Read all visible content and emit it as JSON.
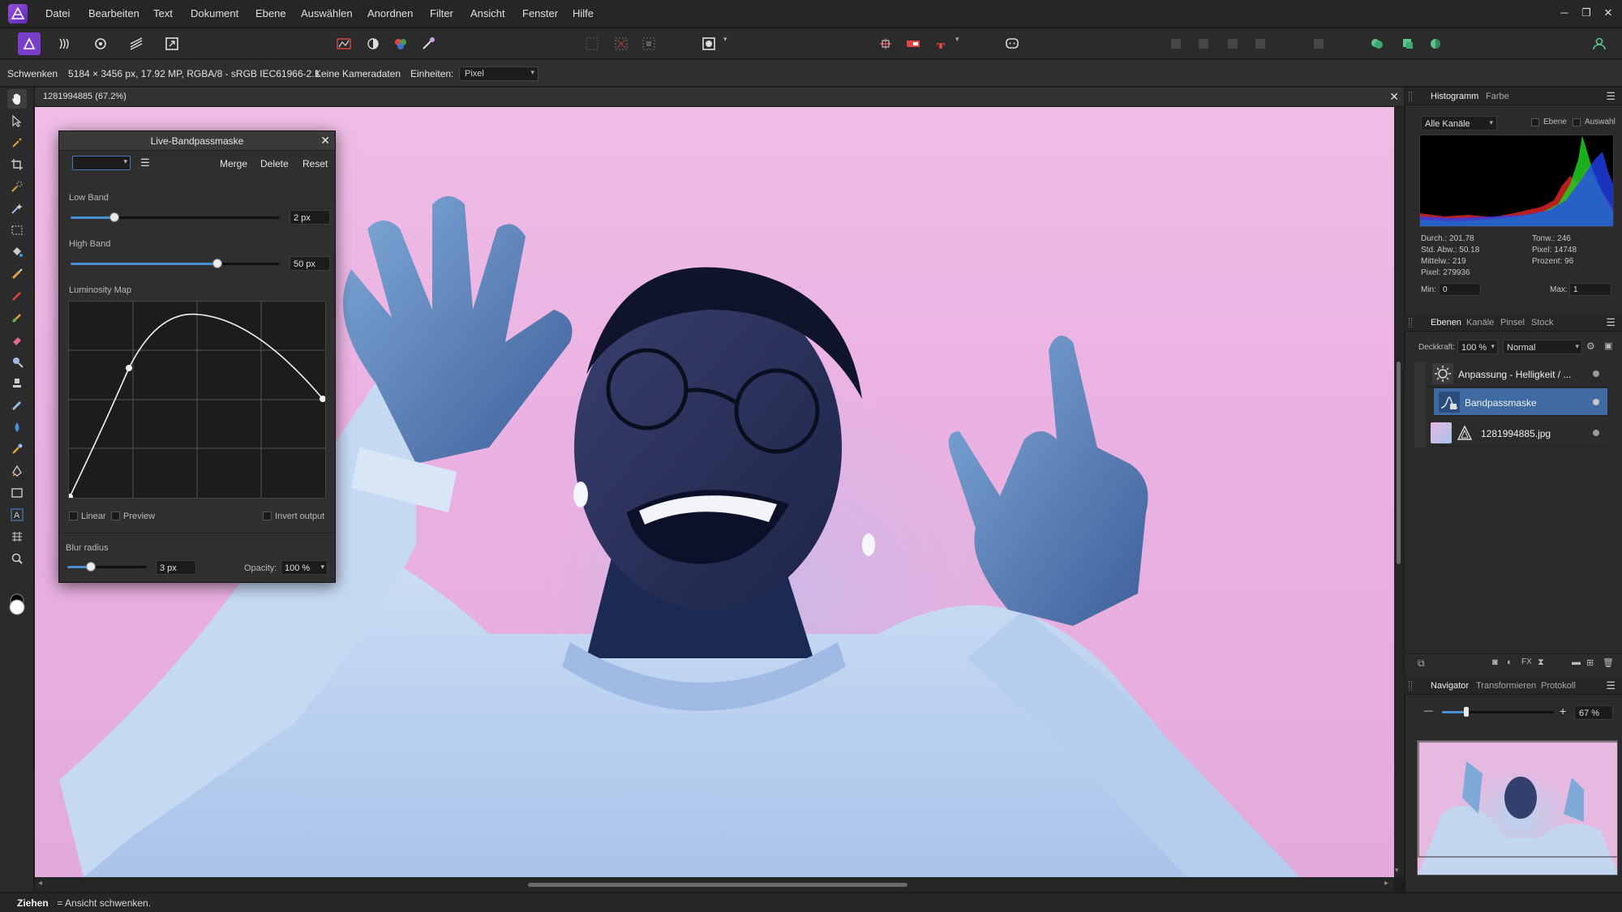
{
  "app": {
    "menu": [
      "Datei",
      "Bearbeiten",
      "Text",
      "Dokument",
      "Ebene",
      "Auswählen",
      "Anordnen",
      "Filter",
      "Ansicht",
      "Fenster",
      "Hilfe"
    ],
    "window_controls": [
      "─",
      "❐",
      "✕"
    ]
  },
  "context_bar": {
    "tool_name": "Schwenken",
    "doc_info": "5184 × 3456 px, 17.92 MP, RGBA/8 - sRGB IEC61966-2.1",
    "camera": "Keine Kameradaten",
    "units_label": "Einheiten:",
    "units_value": "Pixel"
  },
  "document": {
    "tab_title": "1281994885 (67.2%)",
    "close": "✕"
  },
  "live_panel": {
    "title": "Live-Bandpassmaske",
    "close": "✕",
    "menu_icon": "☰",
    "buttons": [
      "Merge",
      "Delete",
      "Reset"
    ],
    "low_band": {
      "label": "Low Band",
      "value": "2 px",
      "level": 0.21
    },
    "high_band": {
      "label": "High Band",
      "value": "50 px",
      "level": 0.7
    },
    "luminosity_map": {
      "label": "Luminosity Map"
    },
    "checks": {
      "linear": "Linear",
      "preview": "Preview",
      "invert": "Invert output"
    },
    "blur_radius": {
      "label": "Blur radius",
      "value": "3 px",
      "level": 0.3
    },
    "opacity": {
      "label": "Opacity:",
      "value": "100 %"
    }
  },
  "histogram_panel": {
    "tabs": [
      "Histogramm",
      "Farbe"
    ],
    "channel_select": "Alle Kanäle",
    "opt_layer": "Ebene",
    "opt_selection": "Auswahl",
    "stats_left": [
      "Durch.: 201.78",
      "Std. Abw.: 50.18",
      "Mittelw.: 219",
      "Pixel: 279936"
    ],
    "stats_right": [
      "Tonw.: 246",
      "Pixel: 14748",
      "Prozent: 96"
    ],
    "min_label": "Min:",
    "min_value": "0",
    "max_label": "Max:",
    "max_value": "1"
  },
  "layers_panel": {
    "tabs": [
      "Ebenen",
      "Kanäle",
      "Pinsel",
      "Stock"
    ],
    "opacity_label": "Deckkraft:",
    "opacity_value": "100 %",
    "blend_mode": "Normal",
    "layers": [
      {
        "name": "Anpassung - Helligkeit / ...",
        "selected": false
      },
      {
        "name": "Bandpassmaske",
        "selected": true
      },
      {
        "name": "1281994885.jpg",
        "selected": false
      }
    ]
  },
  "navigator_panel": {
    "tabs": [
      "Navigator",
      "Transformieren",
      "Protokoll"
    ],
    "zoom_minus": "—",
    "zoom_plus": "+",
    "zoom_value": "67 %",
    "zoom_level": 0.22
  },
  "status": {
    "key": "Ziehen",
    "text": " = Ansicht schwenken."
  },
  "colors": {
    "accent": "#4a8fd6",
    "selected_layer": "#3f6aa2",
    "canvas_pink": "#eab2e2"
  }
}
